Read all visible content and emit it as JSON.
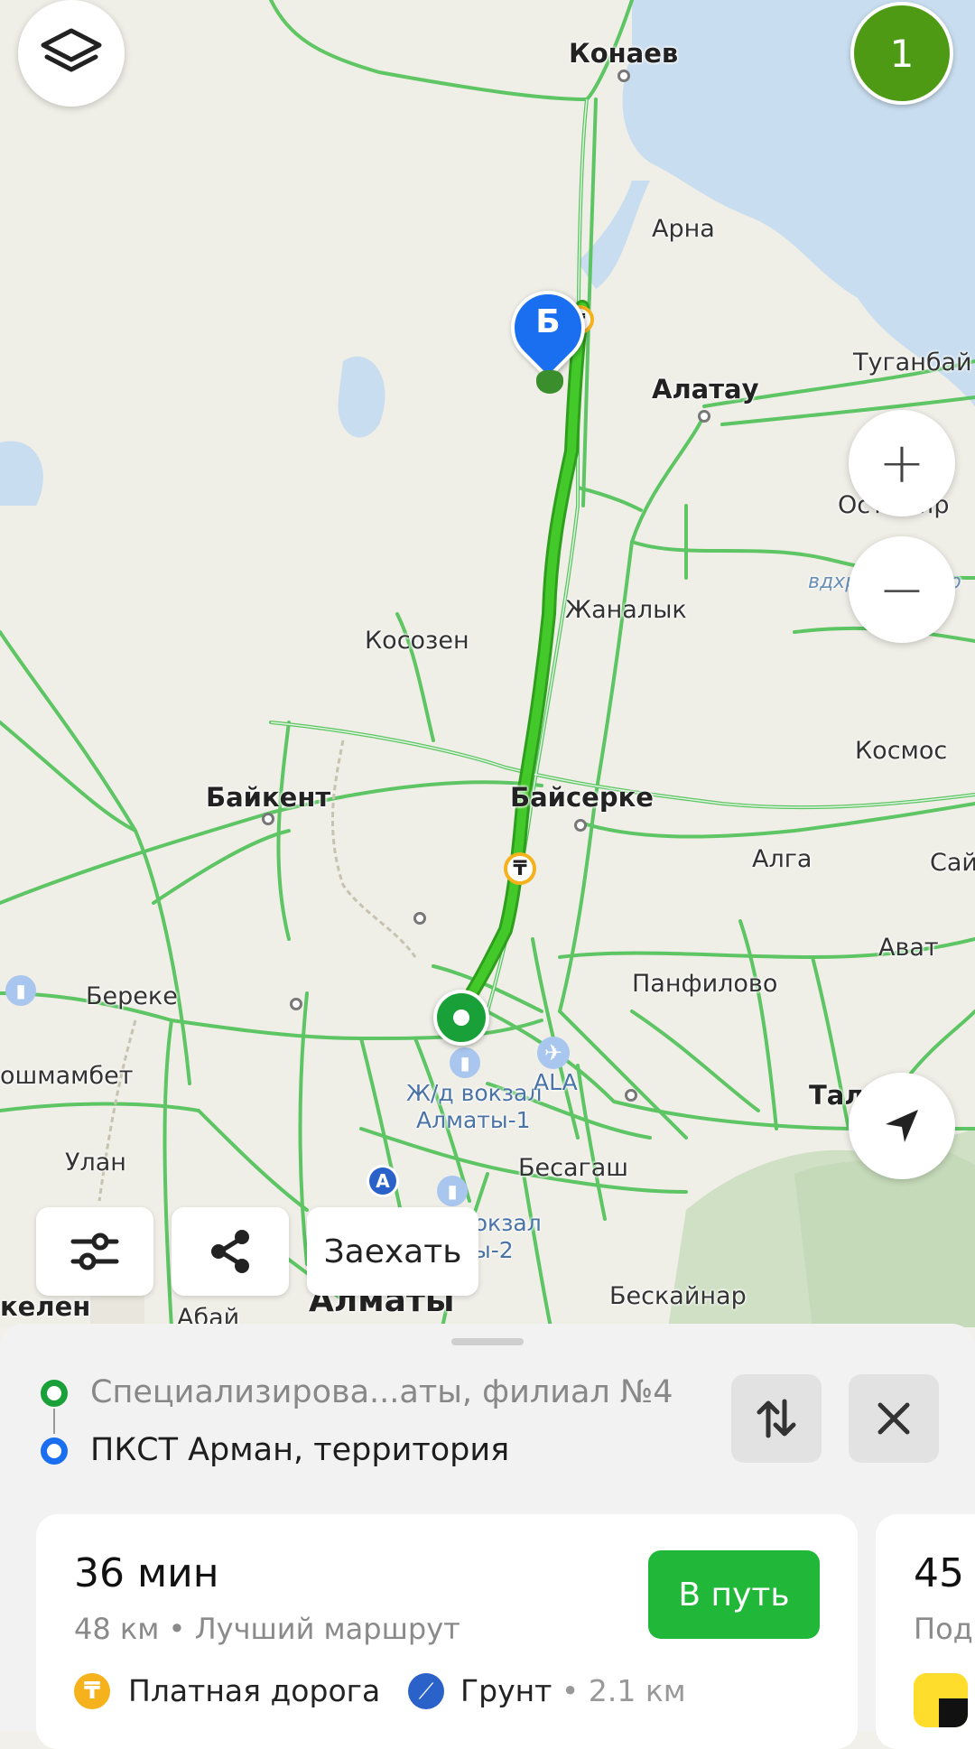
{
  "map": {
    "labels": {
      "konaev": "Конаев",
      "arna": "Арна",
      "tuganbai": "Туганбай",
      "alatau": "Алатау",
      "ostemir": "Остемир",
      "vdkhr": "вдхр. Остемир",
      "zhanalyk": "Жаналык",
      "kosozen": "Косозен",
      "kosmos": "Космос",
      "baikent": "Байкент",
      "baiserke": "Байсерке",
      "alga": "Алга",
      "sai": "Сай",
      "avat": "Ават",
      "bereke": "Береке",
      "panfilovo": "Панфилово",
      "koshmambet": "ошмамбет",
      "zhd1": "Ж/д вокзал",
      "zhd1b": "Алматы-1",
      "ala": "ALA",
      "talgar": "Талгар",
      "ulan": "Улан",
      "besagash": "Бесагаш",
      "zhd2": "вокзал",
      "zhd2b": "ы-2",
      "kelen": "келен",
      "abai": "Абай",
      "almaty": "Алматы",
      "beskainar": "Бескайнар"
    },
    "marker_b": "Б",
    "marker_a": "А",
    "toll_symbol": "₸",
    "notifications_count": "1"
  },
  "controls": {
    "layers_icon": "layers-icon",
    "zoom_in": "+",
    "zoom_out": "−",
    "filters_icon": "sliders-icon",
    "share_icon": "share-icon",
    "drive_in_label": "Заехать"
  },
  "route": {
    "from": "Специализирова...аты, филиал №4",
    "to": "ПКСТ Арман, территория",
    "swap_icon": "swap-icon",
    "close_icon": "close-icon"
  },
  "options": [
    {
      "time": "36 мин",
      "distance": "48 км",
      "separator": "•",
      "tag": "Лучший маршрут",
      "go_label": "В путь",
      "toll_label": "Платная дорога",
      "unpaved_label": "Грунт",
      "unpaved_sep": "•",
      "unpaved_distance": "2.1 км"
    },
    {
      "time": "45",
      "tag": "Под"
    }
  ],
  "colors": {
    "route": "#33bb1a",
    "roads": "#56c35c",
    "start_marker": "#1aa038",
    "end_marker": "#1a6ff0",
    "go_button": "#21b83a",
    "toll": "#f5b21c",
    "water": "#c5dcf0"
  }
}
